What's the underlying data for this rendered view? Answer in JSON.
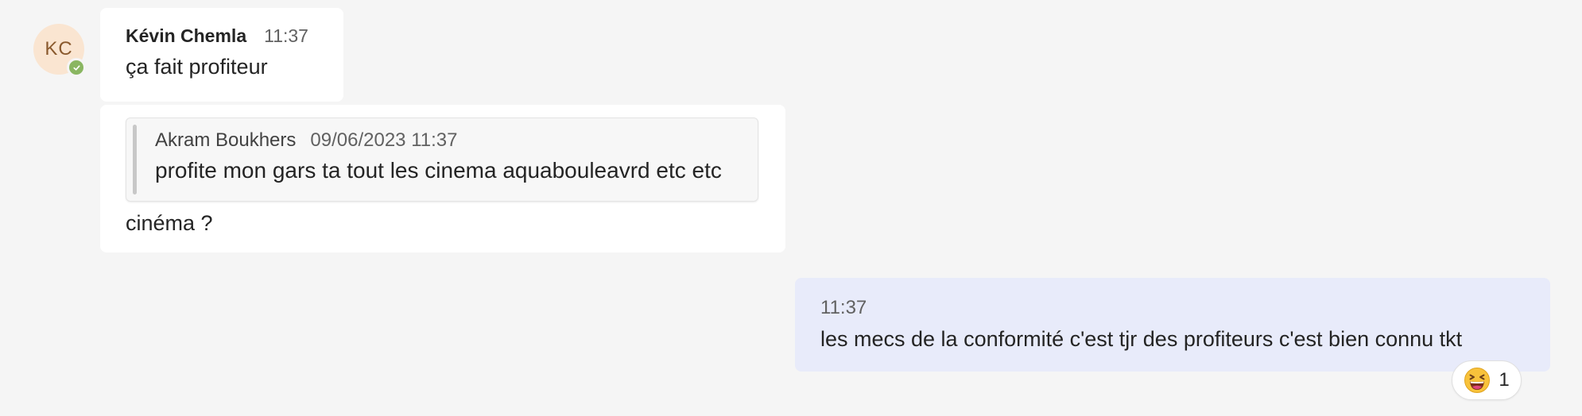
{
  "avatar": {
    "initials": "KC",
    "presence": "available"
  },
  "messages": [
    {
      "sender": "Kévin Chemla",
      "time": "11:37",
      "text": "ça fait profiteur"
    },
    {
      "quote": {
        "author": "Akram Boukhers",
        "datetime": "09/06/2023 11:37",
        "text": "profite mon gars ta tout les cinema aquabouleavrd etc etc"
      },
      "text": "cinéma ?"
    }
  ],
  "outgoing": {
    "time": "11:37",
    "text": "les mecs de la conformité c'est tjr des profiteurs c'est bien connu tkt",
    "reaction": {
      "icon": "laughing-emoji-icon",
      "count": "1"
    }
  },
  "colors": {
    "background": "#f5f5f5",
    "incoming_bubble": "#ffffff",
    "outgoing_bubble": "#e8ebfa",
    "avatar_bg": "#fae5d1",
    "presence": "#8ab661"
  }
}
